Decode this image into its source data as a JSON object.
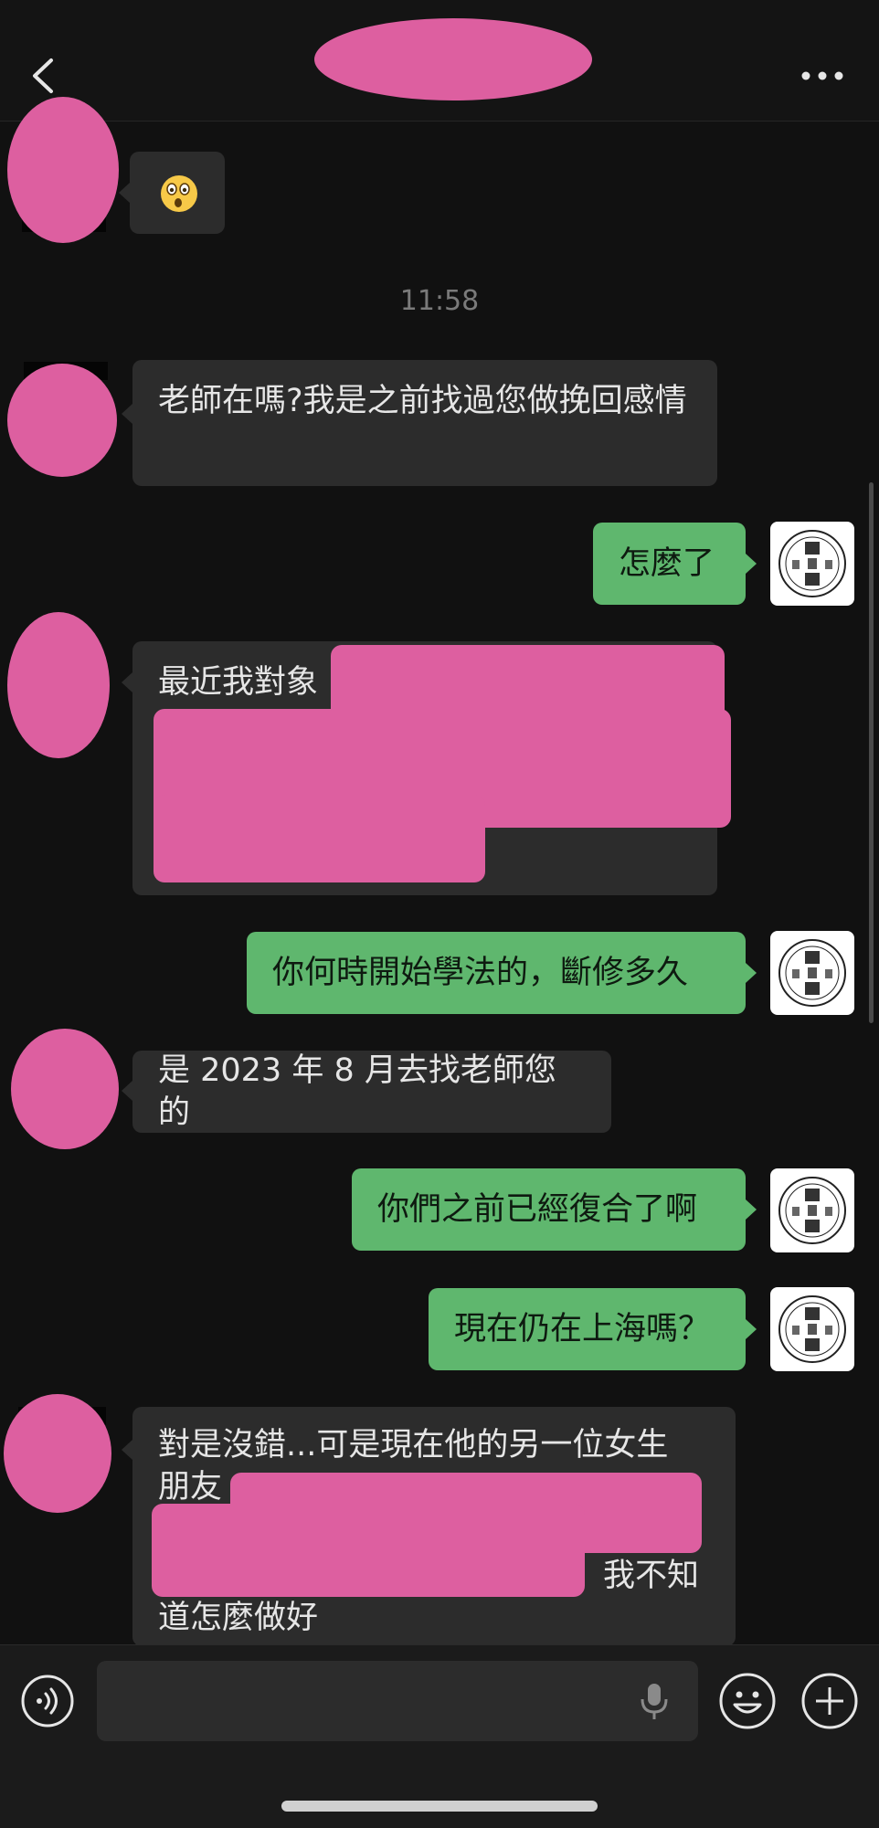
{
  "chat": {
    "timestamp": "11:58",
    "messages": [
      {
        "from": "contact",
        "type": "sticker",
        "icon": "surprised-emoji-icon"
      },
      {
        "from": "contact",
        "text": "老師在嗎?我是之前找過您做挽回感情"
      },
      {
        "from": "me",
        "text": "怎麼了"
      },
      {
        "from": "contact",
        "text": "最近我對象"
      },
      {
        "from": "me",
        "text": "你何時開始學法的，斷修多久"
      },
      {
        "from": "contact",
        "text": "是 2023 年 8 月去找老師您的"
      },
      {
        "from": "me",
        "text": "你們之前已經復合了啊"
      },
      {
        "from": "me",
        "text": "現在仍在上海嗎？"
      },
      {
        "from": "contact",
        "text_line1": "對是沒錯...可是現在他的另一位女生",
        "text_line2": "朋友",
        "text_line3_suffix": "，我不知",
        "text_line4": "道怎麼做好"
      }
    ]
  },
  "header": {
    "back_icon": "chevron-left-icon",
    "more_icon": "ellipsis-icon"
  },
  "bottom_bar": {
    "voice_icon": "voice-icon",
    "mic_icon": "microphone-icon",
    "emoji_icon": "smiley-icon",
    "add_icon": "plus-circle-icon"
  },
  "colors": {
    "outgoing_bubble": "#5fb76e",
    "incoming_bubble": "#2c2c2c",
    "redaction": "#dd5fa0",
    "background": "#111111"
  }
}
